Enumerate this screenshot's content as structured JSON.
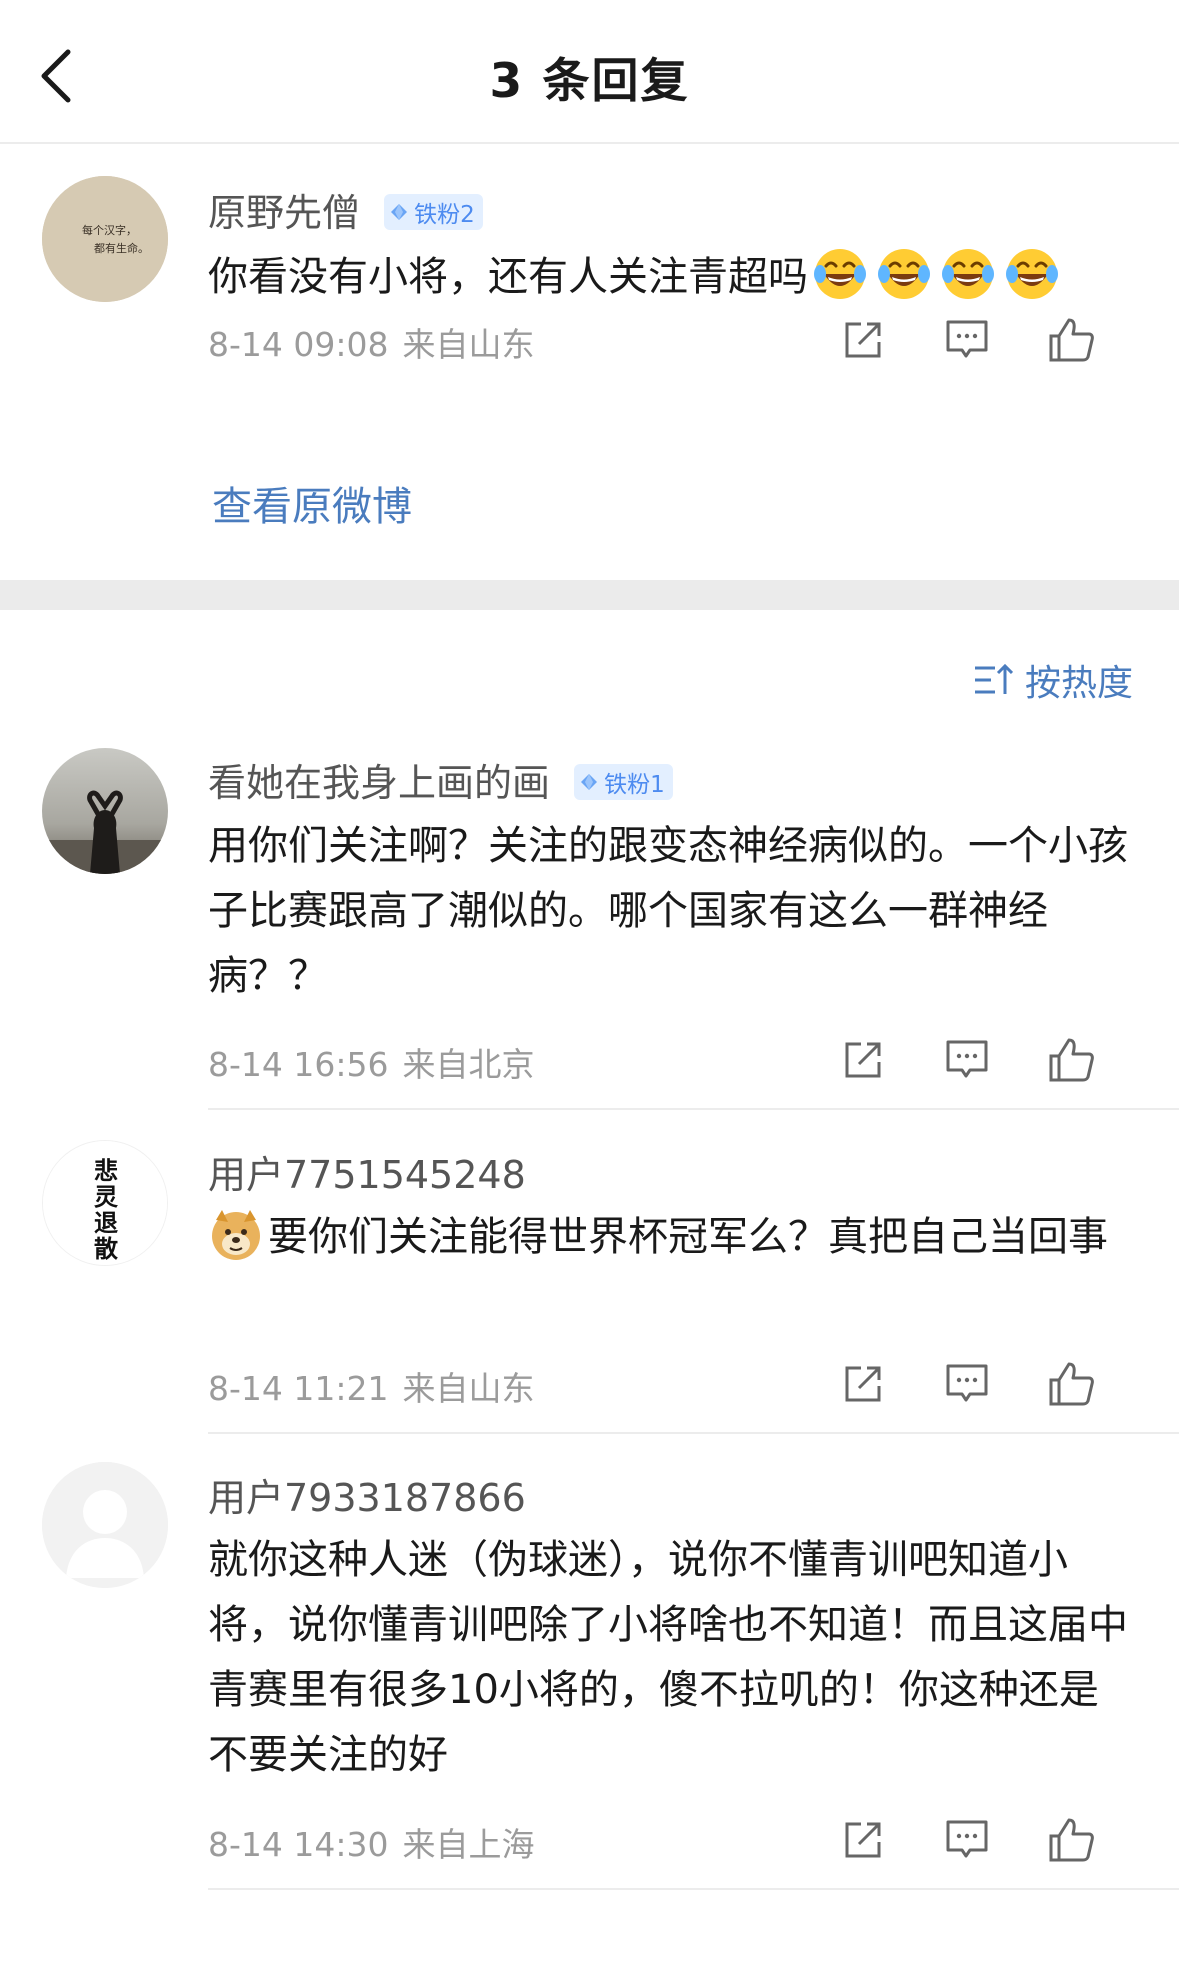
{
  "header": {
    "title": "3 条回复"
  },
  "origin": {
    "avatar_text": "每个汉字，都有生命。",
    "author": "原野先僧",
    "badge": "铁粉2",
    "content": "你看没有小将，还有人关注青超吗",
    "emoji_count": 4,
    "time": "8-14 09:08",
    "location": "来自山东",
    "view_original": "查看原微博"
  },
  "sort": {
    "label": "按热度"
  },
  "replies": [
    {
      "author": "看她在我身上画的画",
      "badge": "铁粉1",
      "content": "用你们关注啊？关注的跟变态神经病似的。一个小孩子比赛跟高了潮似的。哪个国家有这么一群神经病？？",
      "time": "8-14 16:56",
      "location": "来自北京"
    },
    {
      "author": "用户7751545248",
      "avatar_text": "悲灵退散",
      "content": "要你们关注能得世界杯冠军么？真把自己当回事",
      "time": "8-14 11:21",
      "location": "来自山东"
    },
    {
      "author": "用户7933187866",
      "content": "就你这种人迷（伪球迷），说你不懂青训吧知道小将，说你懂青训吧除了小将啥也不知道！而且这届中青赛里有很多10小将的，傻不拉叽的！你这种还是不要关注的好",
      "time": "8-14 14:30",
      "location": "来自上海"
    }
  ],
  "colors": {
    "link": "#4a7cbe",
    "meta": "#9b9b9b",
    "badge_bg": "#e3efff",
    "badge_text": "#4d8bf0",
    "section_gap": "#ebebeb"
  },
  "icons": [
    "back-arrow-icon",
    "share-icon",
    "comment-icon",
    "like-icon",
    "sort-icon",
    "laugh-cry-emoji-icon",
    "doge-emoji-icon",
    "diamond-icon"
  ]
}
